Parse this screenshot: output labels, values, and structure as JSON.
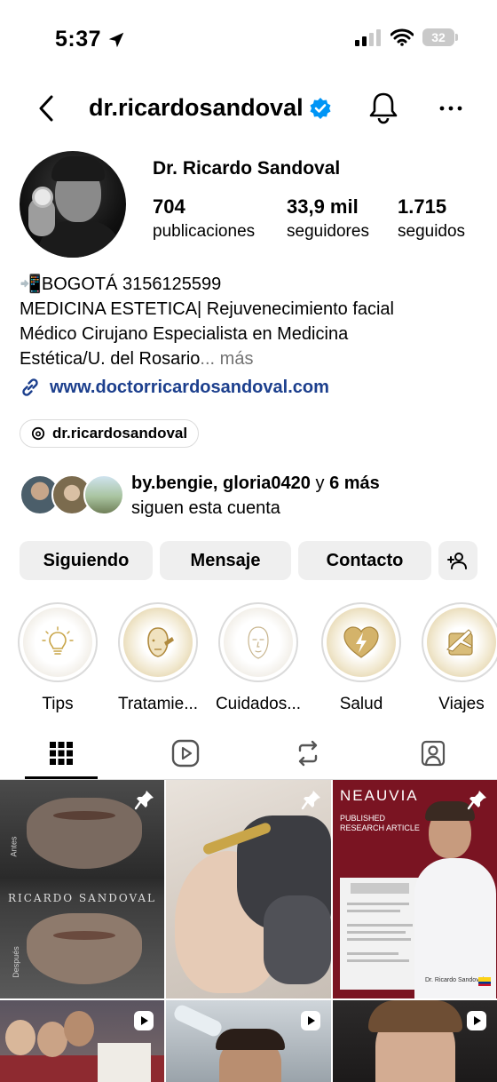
{
  "status_bar": {
    "time": "5:37",
    "battery": "32"
  },
  "nav": {
    "username": "dr.ricardosandoval"
  },
  "profile": {
    "display_name": "Dr. Ricardo Sandoval",
    "stats": [
      {
        "value": "704",
        "label": "publicaciones"
      },
      {
        "value": "33,9 mil",
        "label": "seguidores"
      },
      {
        "value": "1.715",
        "label": "seguidos"
      }
    ]
  },
  "bio": {
    "line1": "📲BOGOTÁ 3156125599",
    "line2": "MEDICINA ESTETICA| Rejuvenecimiento facial",
    "line3": "Médico Cirujano Especialista en Medicina",
    "line4": "Estética/U. del Rosario",
    "ellipsis": "...",
    "more": "más",
    "link": "www.doctorricardosandoval.com",
    "threads_handle": "dr.ricardosandoval"
  },
  "followed_by": {
    "names": "by.bengie, gloria0420",
    "connector": " y ",
    "others": "6 más",
    "suffix": "siguen esta cuenta"
  },
  "actions": {
    "following": "Siguiendo",
    "message": "Mensaje",
    "contact": "Contacto"
  },
  "highlights": [
    {
      "label": "Tips",
      "icon": "lightbulb-icon"
    },
    {
      "label": "Tratamie...",
      "icon": "face-treatment-icon"
    },
    {
      "label": "Cuidados...",
      "icon": "face-outline-icon"
    },
    {
      "label": "Salud",
      "icon": "heart-bolt-icon"
    },
    {
      "label": "Viajes",
      "icon": "travel-icon"
    }
  ],
  "tabs": [
    "grid",
    "reels",
    "reposts",
    "tagged"
  ],
  "grid_posts": [
    {
      "overlay_text": "RICARDO SANDOVAL",
      "before_label": "Antes",
      "after_label": "Después",
      "pinned": true
    },
    {
      "pinned": true
    },
    {
      "brand": "NEAUVIA",
      "line1": "PUBLISHED",
      "line2": "RESEARCH ARTICLE",
      "caption": "Dr. Ricardo Sandoval",
      "pinned": true
    },
    {
      "type": "reel"
    },
    {
      "type": "reel"
    },
    {
      "type": "reel"
    }
  ],
  "colors": {
    "link": "#1c3f8d",
    "verified": "#0095f6",
    "button_bg": "#efefef",
    "muted": "#737373",
    "neauvia_red": "#7a1422"
  }
}
